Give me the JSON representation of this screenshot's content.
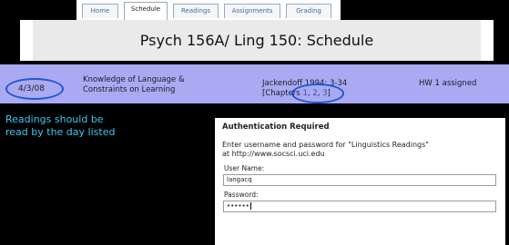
{
  "tabs": [
    {
      "label": "Home"
    },
    {
      "label": "Schedule"
    },
    {
      "label": "Readings"
    },
    {
      "label": "Assignments"
    },
    {
      "label": "Grading"
    }
  ],
  "header": {
    "title": "Psych 156A/ Ling 150: Schedule"
  },
  "schedule_row": {
    "date": "4/3/08",
    "topic_line1": "Knowledge of Language &",
    "topic_line2": "Constraints on Learning",
    "reading_line1": "Jackendoff 1994: 3-34",
    "reading_prefix": "[Chapters ",
    "chapter_links": [
      "1",
      "2",
      "3"
    ],
    "reading_suffix": "]",
    "assignment": "HW 1 assigned"
  },
  "annotation": {
    "line1": "Readings should be",
    "line2": "read by the day listed"
  },
  "auth_dialog": {
    "title": "Authentication Required",
    "message_line1": "Enter username and password for \"Linguistics Readings\"",
    "message_line2": "at http://www.socsci.uci.edu",
    "username_label": "User Name:",
    "username_value": "langacq",
    "password_label": "Password:",
    "password_value": "••••••"
  },
  "colors": {
    "row_background": "#aaaaf3",
    "highlight_oval": "#1e56d6",
    "annotation_text": "#3ac8f0"
  }
}
